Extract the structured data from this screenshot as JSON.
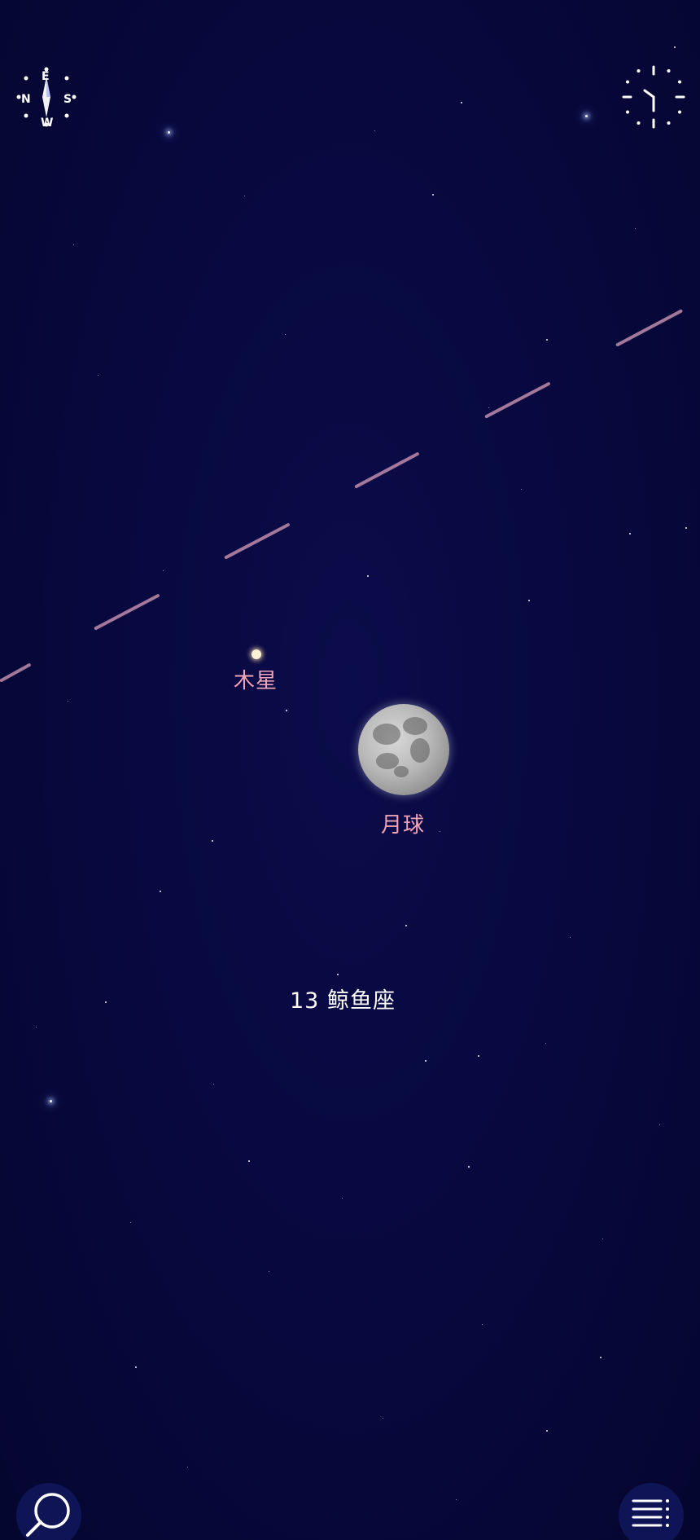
{
  "labels": {
    "jupiter": "木星",
    "moon": "月球",
    "constellation": "13 鲸鱼座"
  },
  "compass": {
    "letters": [
      "N",
      "E",
      "S",
      "W"
    ]
  },
  "icons": {
    "compass": "compass-icon",
    "clock": "clock-icon",
    "search": "search-icon",
    "menu": "menu-icon"
  },
  "colors": {
    "sky": "#07083a",
    "planet_label": "#f3a3b7",
    "constellation_label": "#ffffff",
    "ecliptic": "#be8caa"
  }
}
